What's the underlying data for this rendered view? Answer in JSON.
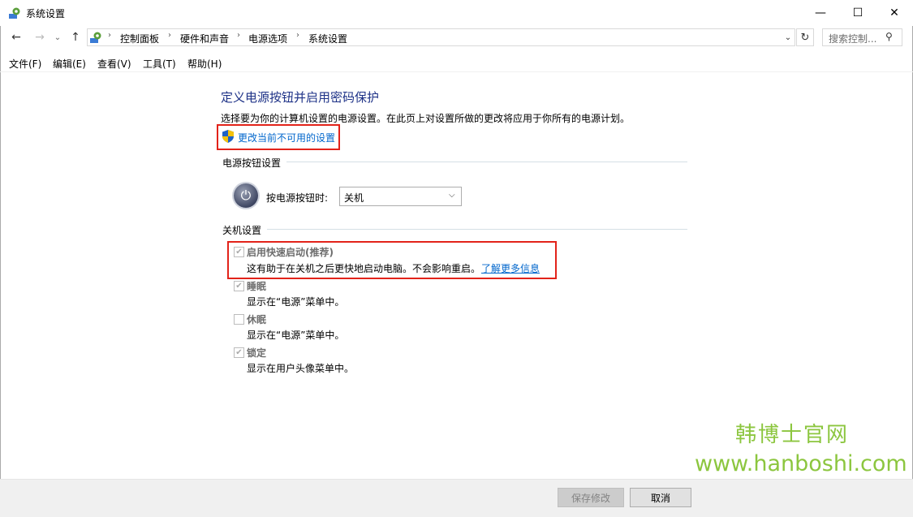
{
  "window": {
    "title": "系统设置"
  },
  "titlebar_buttons": {
    "minimize": "—",
    "maximize": "☐",
    "close": "✕"
  },
  "nav": {
    "back": "←",
    "forward": "→",
    "recent": "⌄",
    "up": "↑",
    "breadcrumbs": [
      "控制面板",
      "硬件和声音",
      "电源选项",
      "系统设置"
    ],
    "separator": "›",
    "dropdown": "⌄",
    "refresh": "↻",
    "search_placeholder": "搜索控制...",
    "search_icon": "⚲"
  },
  "menu": [
    "文件(F)",
    "编辑(E)",
    "查看(V)",
    "工具(T)",
    "帮助(H)"
  ],
  "content": {
    "title": "定义电源按钮并启用密码保护",
    "description": "选择要为你的计算机设置的电源设置。在此页上对设置所做的更改将应用于你所有的电源计划。",
    "change_link": "更改当前不可用的设置",
    "power_section": "电源按钮设置",
    "power_button_label": "按电源按钮时:",
    "power_button_value": "关机",
    "shutdown_section": "关机设置",
    "options": [
      {
        "title": "启用快速启动(推荐)",
        "desc": "这有助于在关机之后更快地启动电脑。不会影响重启。",
        "checked": true
      },
      {
        "title": "睡眠",
        "desc": "显示在“电源”菜单中。",
        "checked": true
      },
      {
        "title": "休眠",
        "desc": "显示在“电源”菜单中。",
        "checked": false
      },
      {
        "title": "锁定",
        "desc": "显示在用户头像菜单中。",
        "checked": true
      }
    ],
    "learn_more": "了解更多信息"
  },
  "watermark": {
    "name": "韩博士官网",
    "url": "www.hanboshi.com"
  },
  "footer": {
    "save": "保存修改",
    "cancel": "取消"
  },
  "colors": {
    "link": "#0066cc",
    "title": "#1e3287",
    "highlight": "#e2231a",
    "watermark": "#8cc63f"
  }
}
